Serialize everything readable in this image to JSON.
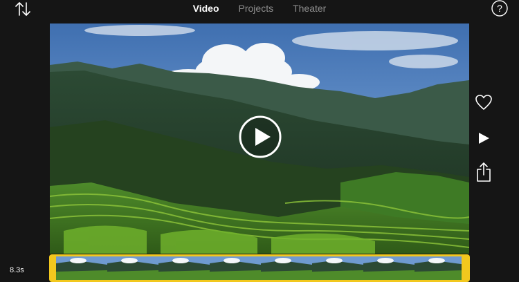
{
  "header": {
    "tabs": [
      {
        "label": "Video",
        "active": true
      },
      {
        "label": "Projects",
        "active": false
      },
      {
        "label": "Theater",
        "active": false
      }
    ],
    "sort_icon": "sort-arrows-icon",
    "help_icon": "help-icon",
    "help_label": "?"
  },
  "viewer": {
    "play_icon": "play-icon"
  },
  "sidebar": {
    "favorite_icon": "heart-icon",
    "play_icon": "play-icon",
    "share_icon": "share-icon"
  },
  "timeline": {
    "duration": "8.3s",
    "thumbnail_count": 8,
    "accent_color": "#f2c81e"
  },
  "colors": {
    "background": "#151515",
    "active_tab": "#ffffff",
    "inactive_tab": "#8e8e8e"
  }
}
